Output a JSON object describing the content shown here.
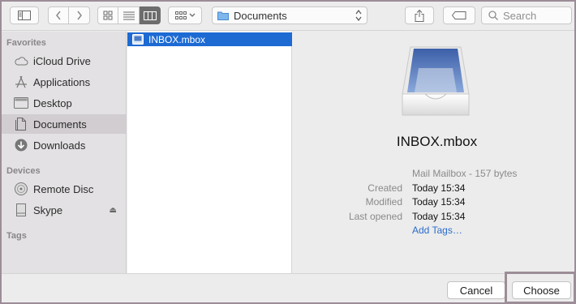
{
  "toolbar": {
    "location_label": "Documents",
    "search_placeholder": "Search"
  },
  "sidebar": {
    "favorites_heading": "Favorites",
    "devices_heading": "Devices",
    "tags_heading": "Tags",
    "items": [
      {
        "label": "iCloud Drive",
        "icon": "cloud-icon"
      },
      {
        "label": "Applications",
        "icon": "applications-icon"
      },
      {
        "label": "Desktop",
        "icon": "desktop-icon"
      },
      {
        "label": "Documents",
        "icon": "documents-icon",
        "selected": true
      },
      {
        "label": "Downloads",
        "icon": "downloads-icon"
      }
    ],
    "devices": [
      {
        "label": "Remote Disc",
        "icon": "disc-icon"
      },
      {
        "label": "Skype",
        "icon": "drive-icon",
        "eject": "⏏"
      }
    ]
  },
  "files": [
    {
      "label": "INBOX.mbox",
      "selected": true
    }
  ],
  "preview": {
    "name": "INBOX.mbox",
    "kind": "Mail Mailbox - 157 bytes",
    "created_label": "Created",
    "created_value": "Today 15:34",
    "modified_label": "Modified",
    "modified_value": "Today 15:34",
    "opened_label": "Last opened",
    "opened_value": "Today 15:34",
    "add_tags": "Add Tags…"
  },
  "buttons": {
    "cancel": "Cancel",
    "choose": "Choose"
  },
  "colors": {
    "selection": "#1d6ad3",
    "link": "#2a6ccc",
    "highlight_border": "#9c8d97"
  }
}
